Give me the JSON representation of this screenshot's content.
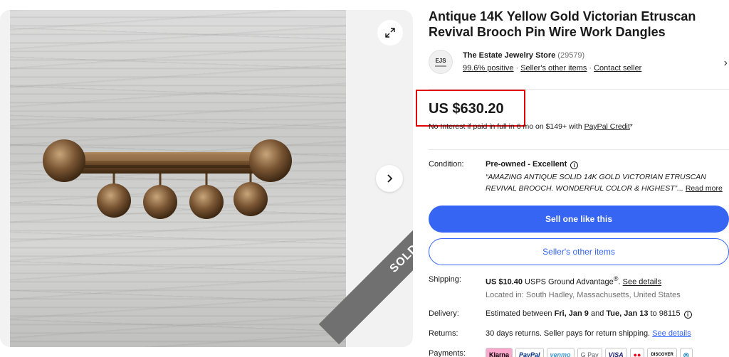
{
  "gallery": {
    "sold_label": "SOLD",
    "expand_icon": "expand-icon",
    "next_icon": "chevron-right-icon"
  },
  "listing": {
    "title": "Antique 14K Yellow Gold Victorian Etruscan Revival Brooch Pin Wire Work Dangles"
  },
  "seller": {
    "logo_text": "EJS",
    "name": "The Estate Jewelry Store",
    "feedback_count": "(29579)",
    "positive": "99.6% positive",
    "other_items": "Seller's other items",
    "contact": "Contact seller"
  },
  "price": {
    "amount": "US $630.20",
    "credit_prefix": "No Interest if paid in full in 6 mo on $149+ with ",
    "credit_link": "PayPal Credit",
    "credit_suffix": "*",
    "highlight_color": "#e00000"
  },
  "condition": {
    "label": "Condition:",
    "value": "Pre-owned - Excellent",
    "description": "“AMAZING ANTIQUE SOLID 14K GOLD VICTORIAN ETRUSCAN REVIVAL BROOCH. WONDERFUL COLOR & HIGHEST”...",
    "read_more": "Read more"
  },
  "actions": {
    "primary": "Sell one like this",
    "secondary": "Seller's other items",
    "accent_color": "#3665f3"
  },
  "shipping": {
    "label": "Shipping:",
    "cost": "US $10.40",
    "service": " USPS Ground Advantage",
    "reg": "®",
    "see_details": "See details",
    "location": "Located in: South Hadley, Massachusetts, United States"
  },
  "delivery": {
    "label": "Delivery:",
    "prefix": "Estimated between ",
    "start": "Fri, Jan 9",
    "and": " and ",
    "end": "Tue, Jan 13",
    "to": " to 98115"
  },
  "returns": {
    "label": "Returns:",
    "text": "30 days returns. Seller pays for return shipping. ",
    "see_details": "See details"
  },
  "payments": {
    "label": "Payments:",
    "methods": [
      "Klarna",
      "PayPal",
      "venmo",
      "G Pay",
      "VISA",
      "●●",
      "DISCOVER",
      "◎"
    ]
  }
}
